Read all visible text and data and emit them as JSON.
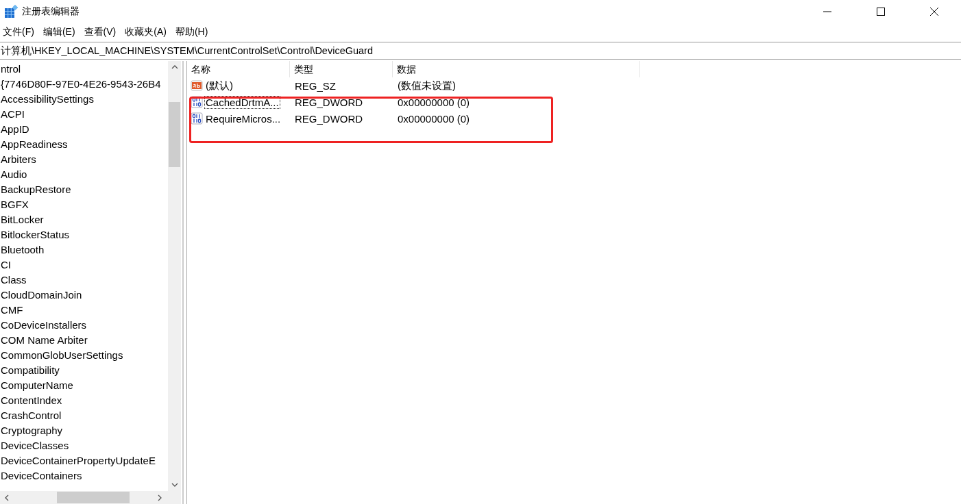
{
  "window": {
    "title": "注册表编辑器"
  },
  "menu": [
    "文件(F)",
    "编辑(E)",
    "查看(V)",
    "收藏夹(A)",
    "帮助(H)"
  ],
  "address": "计算机\\HKEY_LOCAL_MACHINE\\SYSTEM\\CurrentControlSet\\Control\\DeviceGuard",
  "tree": [
    "ntrol",
    "{7746D80F-97E0-4E26-9543-26B4",
    "AccessibilitySettings",
    "ACPI",
    "AppID",
    "AppReadiness",
    "Arbiters",
    "Audio",
    "BackupRestore",
    "BGFX",
    "BitLocker",
    "BitlockerStatus",
    "Bluetooth",
    "CI",
    "Class",
    "CloudDomainJoin",
    "CMF",
    "CoDeviceInstallers",
    "COM Name Arbiter",
    "CommonGlobUserSettings",
    "Compatibility",
    "ComputerName",
    "ContentIndex",
    "CrashControl",
    "Cryptography",
    "DeviceClasses",
    "DeviceContainerPropertyUpdateE",
    "DeviceContainers"
  ],
  "table": {
    "columns": [
      "名称",
      "类型",
      "数据"
    ],
    "rows": [
      {
        "kind": "string",
        "name": "(默认)",
        "type": "REG_SZ",
        "data": "(数值未设置)",
        "focused": false
      },
      {
        "kind": "dword",
        "name": "CachedDrtmA...",
        "type": "REG_DWORD",
        "data": "0x00000000 (0)",
        "focused": true
      },
      {
        "kind": "dword",
        "name": "RequireMicros...",
        "type": "REG_DWORD",
        "data": "0x00000000 (0)",
        "focused": false
      }
    ]
  }
}
